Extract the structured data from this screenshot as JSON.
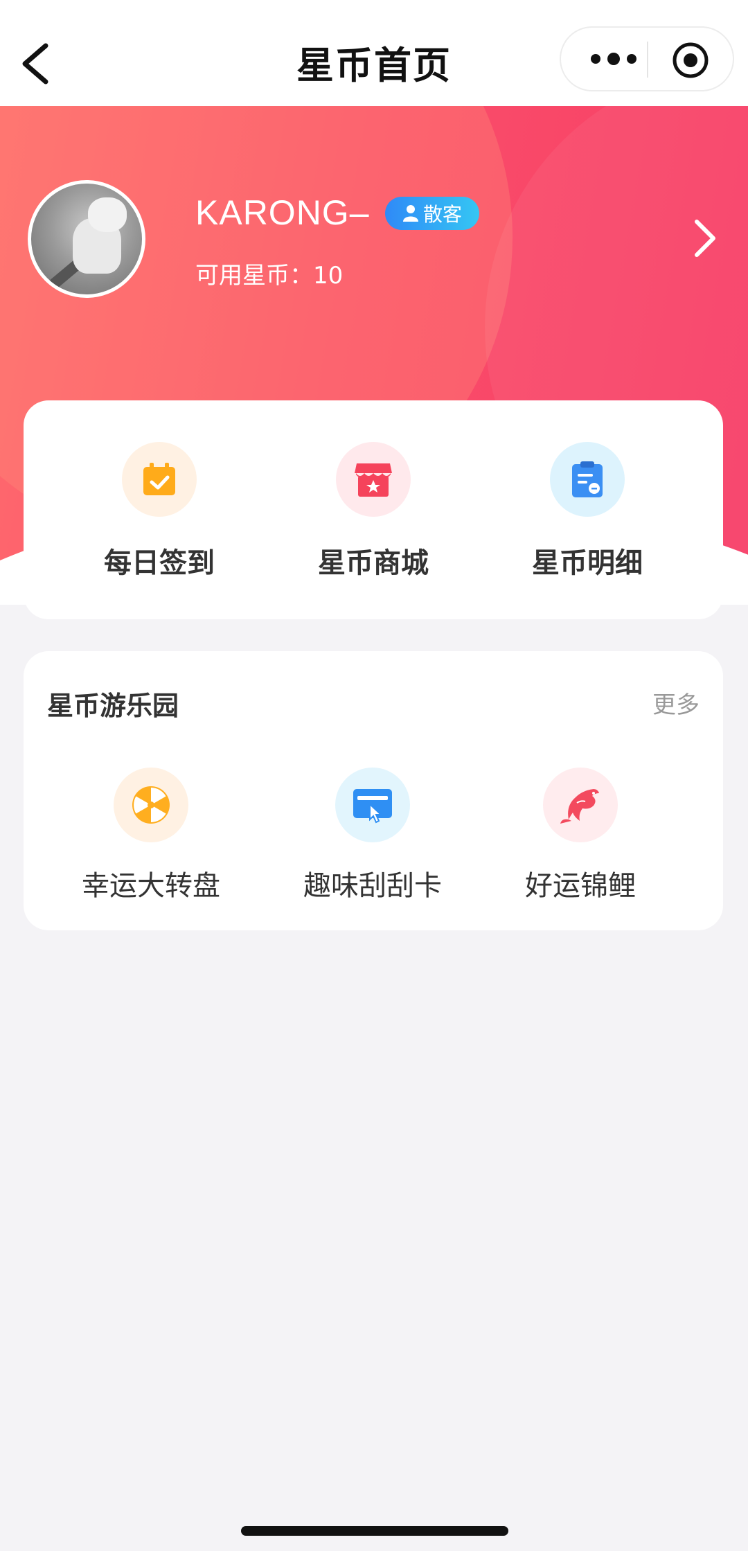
{
  "nav": {
    "title": "星币首页",
    "back_icon": "back-chevron-icon",
    "more_icon": "more-dots-icon",
    "close_icon": "target-circle-icon"
  },
  "profile": {
    "username": "KARONG–",
    "badge": "散客",
    "balance_label": "可用星币：",
    "balance_value": "10"
  },
  "quick_actions": [
    {
      "label": "每日签到",
      "icon": "calendar-check-icon",
      "bg": "#fff1e3",
      "color": "#ffab1a"
    },
    {
      "label": "星币商城",
      "icon": "shop-store-icon",
      "bg": "#ffe9ec",
      "color": "#f5435b"
    },
    {
      "label": "星币明细",
      "icon": "clipboard-detail-icon",
      "bg": "#ddf3fd",
      "color": "#3b8ff3"
    }
  ],
  "park": {
    "title": "星币游乐园",
    "more": "更多",
    "items": [
      {
        "label": "幸运大转盘",
        "icon": "wheel-icon",
        "bg": "#fff1e3",
        "color": "#ffae1f"
      },
      {
        "label": "趣味刮刮卡",
        "icon": "scratch-card-icon",
        "bg": "#e2f5fd",
        "color": "#2f8ff3"
      },
      {
        "label": "好运锦鲤",
        "icon": "koi-fish-icon",
        "bg": "#ffecee",
        "color": "#f34a5e"
      }
    ]
  },
  "colors": {
    "hero_start": "#ff6b6e",
    "hero_end": "#f73c66",
    "badge": "#2f8af7"
  }
}
